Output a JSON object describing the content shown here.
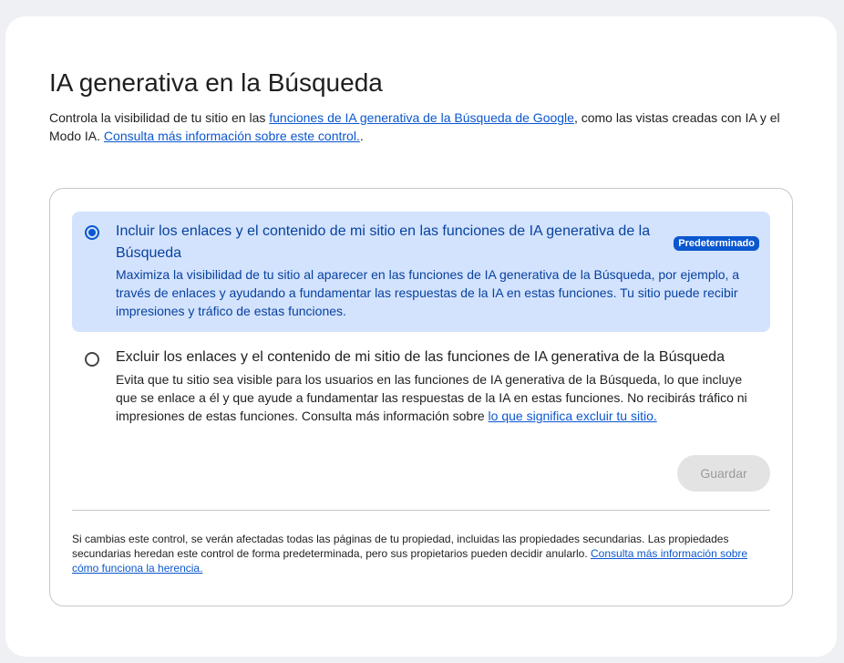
{
  "header": {
    "title": "IA generativa en la Búsqueda",
    "description_prefix": "Controla la visibilidad de tu sitio en las ",
    "description_link1": "funciones de IA generativa de la Búsqueda de Google",
    "description_middle": ", como las vistas creadas con IA y el Modo IA. ",
    "description_link2": "Consulta más información sobre este control.",
    "description_suffix": "."
  },
  "options": [
    {
      "title": "Incluir los enlaces y el contenido de mi sitio en las funciones de IA generativa de la Búsqueda",
      "badge": "Predeterminado",
      "description": "Maximiza la visibilidad de tu sitio al aparecer en las funciones de IA generativa de la Búsqueda, por ejemplo, a través de enlaces y ayudando a fundamentar las respuestas de la IA en estas funciones. Tu sitio puede recibir impresiones y tráfico de estas funciones.",
      "selected": true
    },
    {
      "title": "Excluir los enlaces y el contenido de mi sitio de las funciones de IA generativa de la Búsqueda",
      "description": "Evita que tu sitio sea visible para los usuarios en las funciones de IA generativa de la Búsqueda, lo que incluye que se enlace a él y que ayude a fundamentar las respuestas de la IA en estas funciones. No recibirás tráfico ni impresiones de estas funciones. Consulta más información sobre ",
      "link": "lo que significa excluir tu sitio.",
      "selected": false
    }
  ],
  "actions": {
    "save_label": "Guardar",
    "save_enabled": false
  },
  "footer": {
    "note": "Si cambias este control, se verán afectadas todas las páginas de tu propiedad, incluidas las propiedades secundarias. Las propiedades secundarias heredan este control de forma predeterminada, pero sus propietarios pueden decidir anularlo. ",
    "link": "Consulta más información sobre cómo funciona la herencia."
  },
  "colors": {
    "accent": "#0b57d0",
    "selected_background": "#d3e3fd",
    "selected_text": "#0842a0",
    "disabled_button": "#e3e3e3"
  },
  "icons": {
    "selected_radio": "radio-checked-icon",
    "unselected_radio": "radio-unchecked-icon"
  }
}
